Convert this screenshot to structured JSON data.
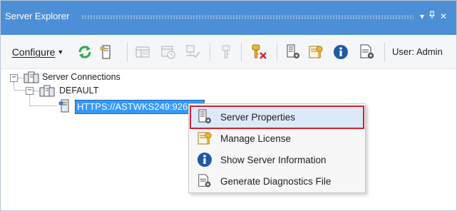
{
  "window": {
    "title": "Server Explorer",
    "pin_glyph": "▾",
    "pin2_glyph": "P",
    "close_glyph": "✕"
  },
  "toolbar": {
    "configure_label": "Configure",
    "user_label": "User: Admin",
    "icons": [
      "refresh-icon",
      "server-tower-icon",
      "panel-icon",
      "calendar-clock-icon",
      "server-check-icon",
      "key-icon",
      "key-delete-icon",
      "server-properties-icon",
      "license-icon",
      "info-icon",
      "diagnostics-icon"
    ]
  },
  "tree": {
    "root_label": "Server Connections",
    "group_label": "DEFAULT",
    "server_label": "HTTPS://ASTWKS249:9260"
  },
  "context_menu": {
    "items": [
      {
        "label": "Server Properties",
        "icon": "server-properties-icon",
        "highlighted": true
      },
      {
        "label": "Manage License",
        "icon": "license-icon",
        "highlighted": false
      },
      {
        "label": "Show Server Information",
        "icon": "info-icon",
        "highlighted": false
      },
      {
        "label": "Generate Diagnostics File",
        "icon": "diagnostics-icon",
        "highlighted": false
      }
    ]
  },
  "colors": {
    "titlebar": "#4c8fd6",
    "selection": "#3399ff",
    "highlight_outline": "#d4202f"
  }
}
